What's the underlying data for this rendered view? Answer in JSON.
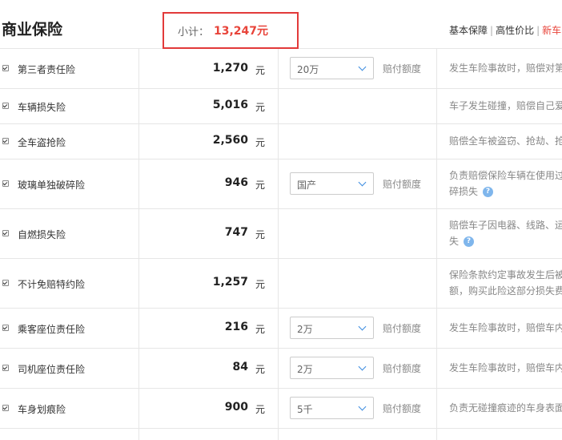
{
  "section_title": "商业保险",
  "subtotal": {
    "label": "小计：",
    "value": "13,247元"
  },
  "tabs": [
    {
      "label": "基本保障"
    },
    {
      "label": "高性价比"
    },
    {
      "label": "新车"
    }
  ],
  "unit": "元",
  "limit_label": "赔付额度",
  "rows": [
    {
      "name": "第三者责任险",
      "price": "1,270",
      "select": "20万",
      "desc1": "发生车险事故时，赔偿对第",
      "desc2": ""
    },
    {
      "name": "车辆损失险",
      "price": "5,016",
      "select": "",
      "desc1": "车子发生碰撞，赔偿自己爱",
      "desc2": ""
    },
    {
      "name": "全车盗抢险",
      "price": "2,560",
      "select": "",
      "desc1": "赔偿全车被盗窃、抢劫、抢",
      "desc2": ""
    },
    {
      "name": "玻璃单独破碎险",
      "price": "946",
      "select": "国产",
      "desc1": "负责赔偿保险车辆在使用过",
      "desc2": "碎损失"
    },
    {
      "name": "自燃损失险",
      "price": "747",
      "select": "",
      "desc1": "赔偿车子因电器、线路、运",
      "desc2": "失"
    },
    {
      "name": "不计免赔特约险",
      "price": "1,257",
      "select": "",
      "desc1": "保险条款约定事故发生后被",
      "desc2": "额，购买此险这部分损失费"
    },
    {
      "name": "乘客座位责任险",
      "price": "216",
      "select": "2万",
      "desc1": "发生车险事故时，赔偿车内",
      "desc2": ""
    },
    {
      "name": "司机座位责任险",
      "price": "84",
      "select": "2万",
      "desc1": "发生车险事故时，赔偿车内",
      "desc2": ""
    },
    {
      "name": "车身划痕险",
      "price": "900",
      "select": "5千",
      "desc1": "负责无碰撞痕迹的车身表面",
      "desc2": ""
    }
  ]
}
